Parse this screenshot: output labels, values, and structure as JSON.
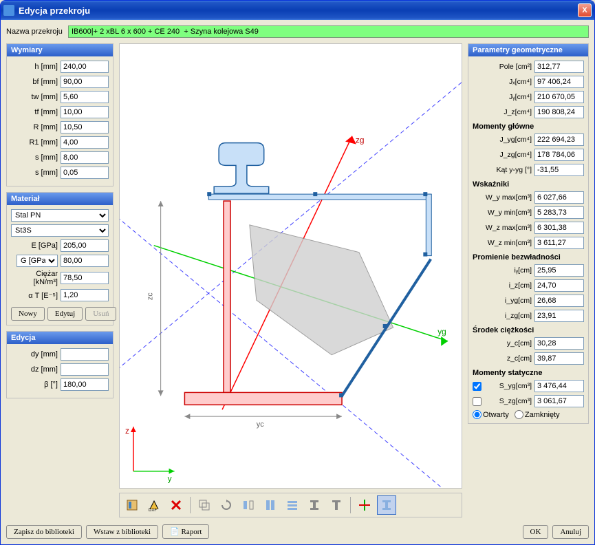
{
  "window": {
    "title": "Edycja przekroju",
    "close": "X"
  },
  "name_label": "Nazwa przekroju",
  "name_value": "IB600|+ 2 xBL 6 x 600 + CE 240  + Szyna kolejowa S49",
  "wymiary": {
    "header": "Wymiary",
    "h_label": "h [mm]",
    "h": "240,00",
    "bf_label": "bf [mm]",
    "bf": "90,00",
    "tw_label": "tw [mm]",
    "tw": "5,60",
    "tf_label": "tf [mm]",
    "tf": "10,00",
    "R_label": "R [mm]",
    "R": "10,50",
    "R1_label": "R1 [mm]",
    "R1": "4,00",
    "s_label": "s [mm]",
    "s": "8,00",
    "s2_label": "s [mm]",
    "s2": "0,05"
  },
  "material": {
    "header": "Materiał",
    "type": "Stal PN",
    "grade": "St3S",
    "E_label": "E [GPa]",
    "E": "205,00",
    "G_label": "G [GPa]",
    "G": "80,00",
    "ciezar_label": "Ciężar [kN/m³]",
    "ciezar": "78,50",
    "alpha_label": "α T [E⁻⁵]",
    "alpha": "1,20",
    "nowy": "Nowy",
    "edytuj": "Edytuj",
    "usun": "Usuń"
  },
  "edycja": {
    "header": "Edycja",
    "dy_label": "dy [mm]",
    "dy": "",
    "dz_label": "dz [mm]",
    "dz": "",
    "beta_label": "β [°]",
    "beta": "180,00"
  },
  "params": {
    "header": "Parametry geometryczne",
    "pole_label": "Pole [cm²]",
    "pole": "312,77",
    "Jx_label": "Jₓ[cm⁴]",
    "Jx": "97 406,24",
    "Jy_label": "Jᵧ[cm⁴]",
    "Jy": "210 670,05",
    "Jz_label": "J_z[cm⁴]",
    "Jz": "190 808,24",
    "mom_glowne": "Momenty główne",
    "Jyg_label": "J_yg[cm⁴]",
    "Jyg": "222 694,23",
    "Jzg_label": "J_zg[cm⁴]",
    "Jzg": "178 784,06",
    "kat_label": "Kąt y-yg [°]",
    "kat": "-31,55",
    "wskazniki": "Wskaźniki",
    "Wymax_label": "W_y max[cm³]",
    "Wymax": "6 027,66",
    "Wymin_label": "W_y min[cm³]",
    "Wymin": "5 283,73",
    "Wzmax_label": "W_z max[cm³]",
    "Wzmax": "6 301,38",
    "Wzmin_label": "W_z min[cm³]",
    "Wzmin": "3 611,27",
    "promienie": "Promienie bezwładności",
    "iy_label": "iᵧ[cm]",
    "iy": "25,95",
    "iz_label": "i_z[cm]",
    "iz": "24,70",
    "iyg_label": "i_yg[cm]",
    "iyg": "26,68",
    "izg_label": "i_zg[cm]",
    "izg": "23,91",
    "srodek": "Środek ciężkości",
    "yc_label": "y_c[cm]",
    "yc": "30,28",
    "zc_label": "z_c[cm]",
    "zc": "39,87",
    "mom_stat": "Momenty statyczne",
    "Syg_label": "S_yg[cm³]",
    "Syg": "3 476,44",
    "Szg_label": "S_zg[cm³]",
    "Szg": "3 061,67",
    "otwarty": "Otwarty",
    "zamkniety": "Zamknięty"
  },
  "axes": {
    "y": "y",
    "z": "z",
    "yg": "yg",
    "zg": "zg",
    "yc": "yc",
    "zc": "zc"
  },
  "bottom": {
    "zapisz": "Zapisz do biblioteki",
    "wstaw": "Wstaw z biblioteki",
    "raport": "Raport",
    "ok": "OK",
    "anuluj": "Anuluj"
  }
}
